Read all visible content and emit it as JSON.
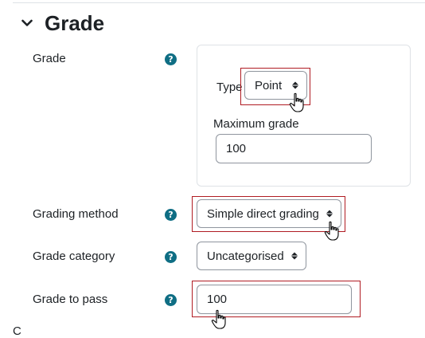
{
  "section": {
    "title": "Grade",
    "chevron_icon": "chevron-down-icon"
  },
  "fields": {
    "grade": {
      "label": "Grade",
      "help_icon": "question-circle-icon",
      "help_glyph": "?"
    },
    "type": {
      "label": "Type",
      "selected": "Point"
    },
    "max_grade": {
      "label": "Maximum grade",
      "value": "100"
    },
    "grading_method": {
      "label": "Grading method",
      "selected": "Simple direct grading",
      "help_glyph": "?"
    },
    "grade_category": {
      "label": "Grade category",
      "selected": "Uncategorised",
      "help_glyph": "?"
    },
    "grade_to_pass": {
      "label": "Grade to pass",
      "value": "100",
      "help_glyph": "?"
    }
  },
  "cutoff_text": "C",
  "colors": {
    "help_icon": "#0f6e84",
    "highlight": "#b01c23",
    "border": "#8f959e"
  }
}
